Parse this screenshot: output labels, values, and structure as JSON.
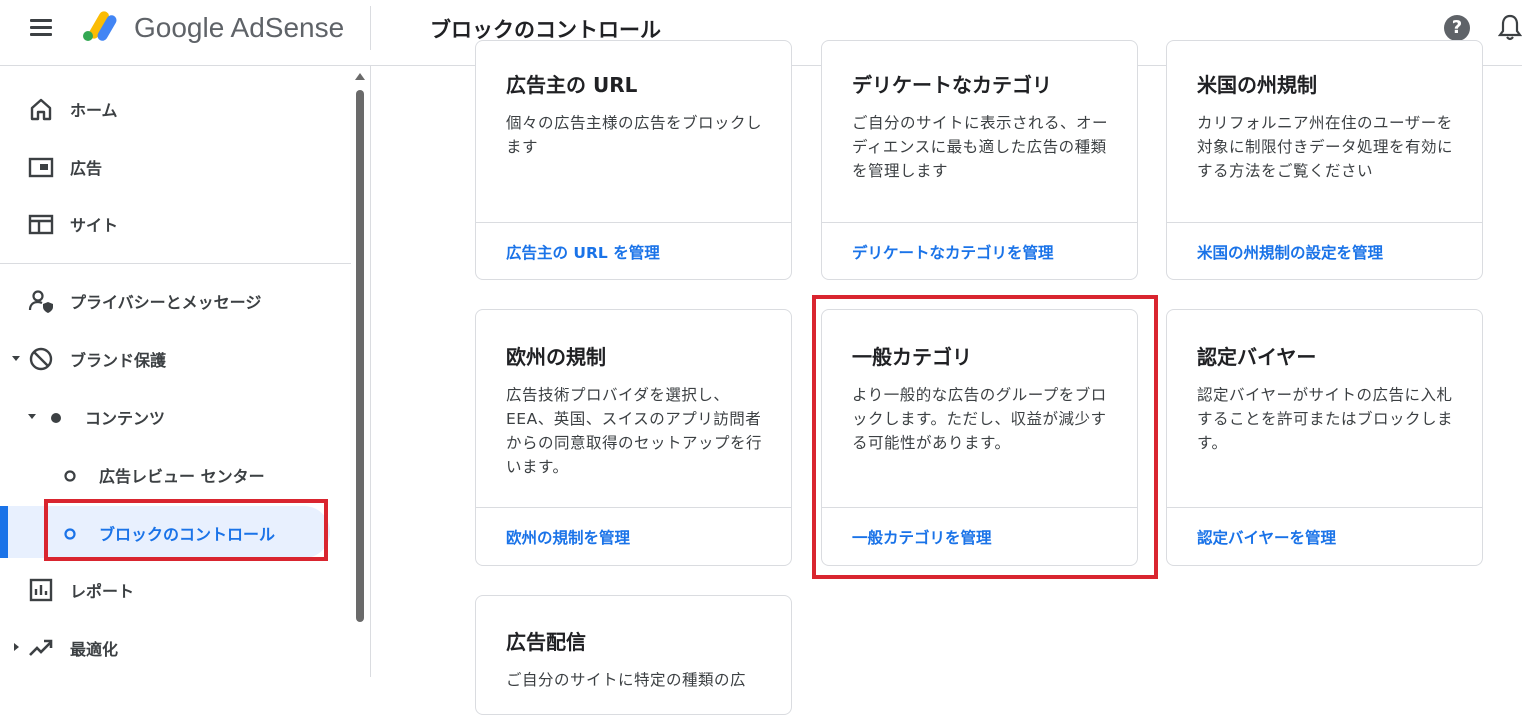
{
  "header": {
    "brand": "Google AdSense",
    "page_title": "ブロックのコントロール",
    "help_glyph": "?"
  },
  "sidebar": {
    "items": [
      {
        "label": "ホーム",
        "icon": "home-icon"
      },
      {
        "label": "広告",
        "icon": "ads-icon"
      },
      {
        "label": "サイト",
        "icon": "sites-icon"
      },
      {
        "label": "プライバシーとメッセージ",
        "icon": "privacy-icon"
      },
      {
        "label": "ブランド保護",
        "icon": "block-icon"
      },
      {
        "label": "コンテンツ",
        "icon": "dot-icon"
      },
      {
        "label": "広告レビュー センター",
        "icon": "circle-icon"
      },
      {
        "label": "ブロックのコントロール",
        "icon": "circle-icon",
        "active": true
      },
      {
        "label": "レポート",
        "icon": "reports-icon"
      },
      {
        "label": "最適化",
        "icon": "trending-icon"
      }
    ]
  },
  "cards": [
    {
      "title": "広告主の URL",
      "desc": "個々の広告主様の広告をブロックします",
      "link": "広告主の URL を管理"
    },
    {
      "title": "デリケートなカテゴリ",
      "desc": "ご自分のサイトに表示される、オーディエンスに最も適した広告の種類を管理します",
      "link": "デリケートなカテゴリを管理"
    },
    {
      "title": "米国の州規制",
      "desc": "カリフォルニア州在住のユーザーを対象に制限付きデータ処理を有効にする方法をご覧ください",
      "link": "米国の州規制の設定を管理"
    },
    {
      "title": "欧州の規制",
      "desc": "広告技術プロバイダを選択し、EEA、英国、スイスのアプリ訪問者からの同意取得のセットアップを行います。",
      "link": "欧州の規制を管理"
    },
    {
      "title": "一般カテゴリ",
      "desc": "より一般的な広告のグループをブロックします。ただし、収益が減少する可能性があります。",
      "link": "一般カテゴリを管理"
    },
    {
      "title": "認定バイヤー",
      "desc": "認定バイヤーがサイトの広告に入札することを許可またはブロックします。",
      "link": "認定バイヤーを管理"
    },
    {
      "title": "広告配信",
      "desc": "ご自分のサイトに特定の種類の広",
      "link": ""
    }
  ],
  "colors": {
    "accent": "#1a73e8",
    "highlight_box": "#d9252f",
    "active_bg": "#e8f0fe"
  }
}
